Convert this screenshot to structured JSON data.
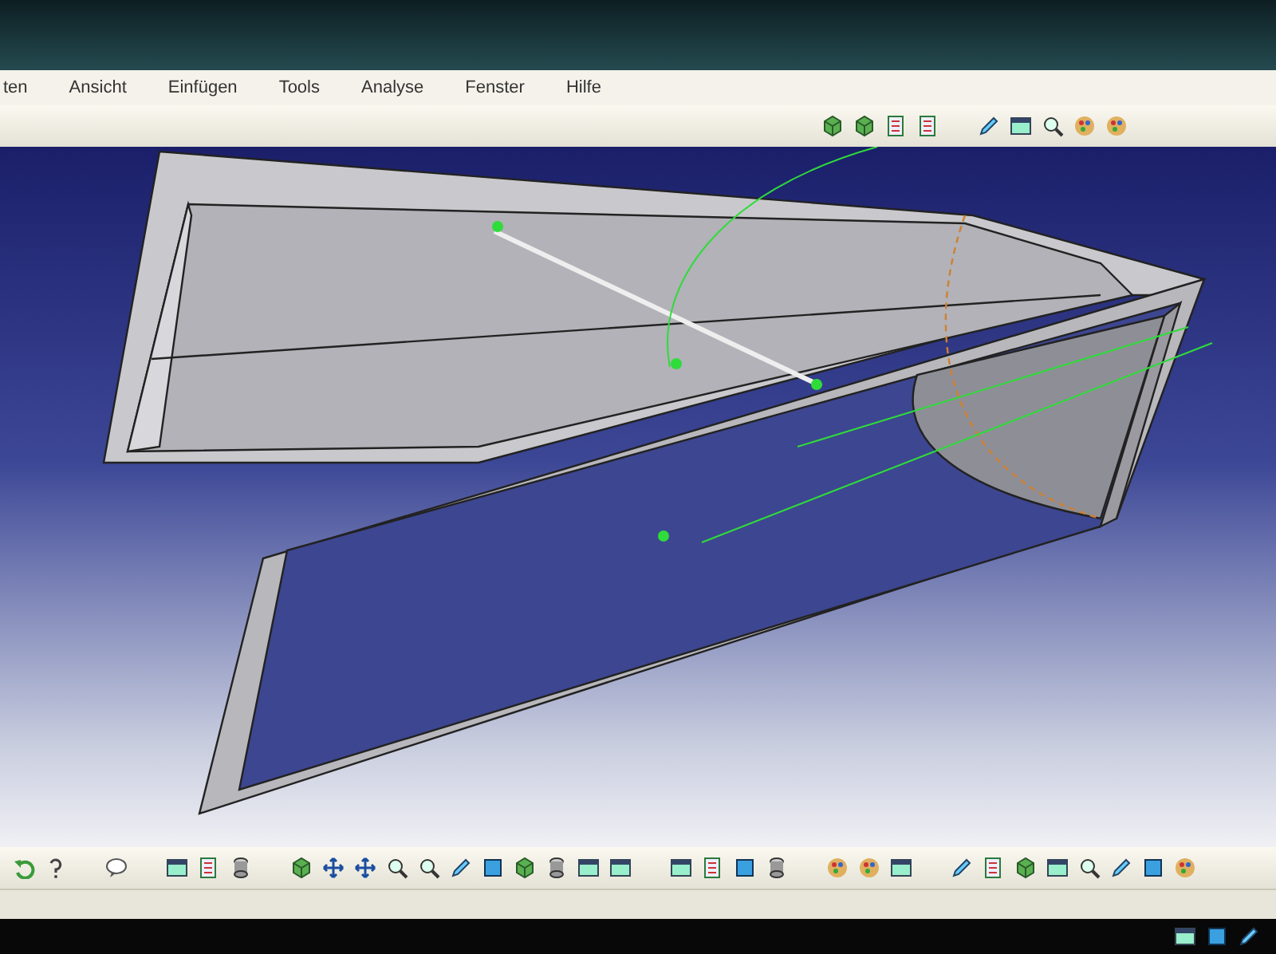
{
  "menu_bar": {
    "items": [
      {
        "label": "ten"
      },
      {
        "label": "Ansicht"
      },
      {
        "label": "Einfügen"
      },
      {
        "label": "Tools"
      },
      {
        "label": "Analyse"
      },
      {
        "label": "Fenster"
      },
      {
        "label": "Hilfe"
      }
    ]
  }
}
